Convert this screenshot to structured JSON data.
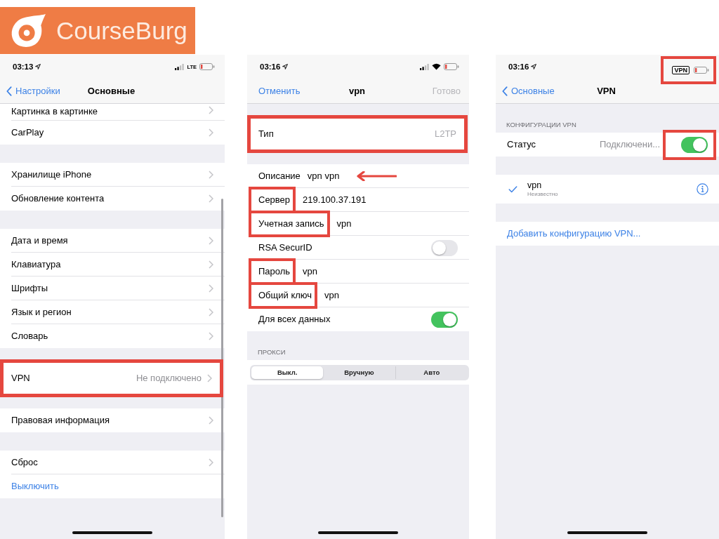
{
  "logo": {
    "name": "CourseBurg"
  },
  "screens": [
    {
      "scrolled": true,
      "status_bar": {
        "time": "03:13",
        "indicators_highlighted": false,
        "indicators": [
          {
            "kind": "signal"
          },
          {
            "kind": "text",
            "text": "LTE"
          },
          {
            "kind": "battery"
          }
        ]
      },
      "nav_bar": {
        "left": {
          "kind": "back",
          "text": "Настройки"
        },
        "title": "Основные"
      },
      "sections": [
        {
          "rows": [
            {
              "kind": "link",
              "label": "Картинка в картинке",
              "highlighted": false
            },
            {
              "kind": "link",
              "label": "CarPlay",
              "highlighted": false
            }
          ]
        },
        {
          "rows": [
            {
              "kind": "link",
              "label": "Хранилище iPhone",
              "highlighted": false
            },
            {
              "kind": "link",
              "label": "Обновление контента",
              "highlighted": false
            }
          ]
        },
        {
          "rows": [
            {
              "kind": "link",
              "label": "Дата и время",
              "highlighted": false
            },
            {
              "kind": "link",
              "label": "Клавиатура",
              "highlighted": false
            },
            {
              "kind": "link",
              "label": "Шрифты",
              "highlighted": false
            },
            {
              "kind": "link",
              "label": "Язык и регион",
              "highlighted": false
            },
            {
              "kind": "link",
              "label": "Словарь",
              "highlighted": false
            }
          ]
        },
        {
          "rows": [
            {
              "kind": "link",
              "label": "VPN",
              "value": "Не подключено",
              "highlighted": true
            }
          ]
        },
        {
          "rows": [
            {
              "kind": "link",
              "label": "Правовая информация",
              "highlighted": false
            }
          ]
        },
        {
          "rows": [
            {
              "kind": "link",
              "label": "Сброс",
              "highlighted": false
            },
            {
              "kind": "action",
              "label": "Выключить",
              "highlighted": false
            }
          ]
        }
      ]
    },
    {
      "scrolled": false,
      "status_bar": {
        "time": "03:16",
        "indicators_highlighted": false,
        "indicators": [
          {
            "kind": "signal"
          },
          {
            "kind": "wifi"
          },
          {
            "kind": "battery"
          }
        ]
      },
      "nav_bar": {
        "left": {
          "kind": "cancel",
          "text": "Отменить"
        },
        "title": "vpn",
        "right": {
          "kind": "done",
          "text": "Готово",
          "disabled": true
        }
      },
      "sections": [
        {
          "rows": [
            {
              "kind": "detail",
              "label": "Тип",
              "value": "L2TP",
              "highlighted": true
            }
          ]
        },
        {
          "rows": [
            {
              "kind": "field",
              "label": "Описание",
              "value": "vpn vpn",
              "label_highlighted": false,
              "arrow": true,
              "highlighted": false
            },
            {
              "kind": "field",
              "label": "Сервер",
              "value": "219.100.37.191",
              "label_highlighted": true,
              "arrow": false,
              "highlighted": false
            },
            {
              "kind": "field",
              "label": "Учетная запись",
              "value": "vpn",
              "label_highlighted": true,
              "arrow": false,
              "highlighted": false
            },
            {
              "kind": "toggle",
              "label": "RSA SecurID",
              "on": false,
              "toggle_highlighted": false,
              "highlighted": false
            },
            {
              "kind": "field",
              "label": "Пароль",
              "value": "vpn",
              "label_highlighted": true,
              "arrow": false,
              "highlighted": false
            },
            {
              "kind": "field",
              "label": "Общий ключ",
              "value": "vpn",
              "label_highlighted": true,
              "arrow": false,
              "highlighted": false
            },
            {
              "kind": "toggle",
              "label": "Для всех данных",
              "on": true,
              "toggle_highlighted": false,
              "highlighted": false
            }
          ]
        },
        {
          "header": "ПРОКСИ",
          "rows": [
            {
              "kind": "segmented",
              "highlighted": false,
              "segments": [
                {
                  "label": "Выкл.",
                  "selected": true
                },
                {
                  "label": "Вручную",
                  "selected": false
                },
                {
                  "label": "Авто",
                  "selected": false
                }
              ]
            }
          ]
        }
      ]
    },
    {
      "scrolled": false,
      "status_bar": {
        "time": "03:16",
        "indicators_highlighted": true,
        "indicators": [
          {
            "kind": "badge",
            "text": "VPN"
          },
          {
            "kind": "battery"
          }
        ]
      },
      "nav_bar": {
        "left": {
          "kind": "back",
          "text": "Основные"
        },
        "title": "VPN"
      },
      "sections": [
        {
          "header": "КОНФИГУРАЦИИ VPN",
          "rows": [
            {
              "kind": "toggle",
              "label": "Статус",
              "value": "Подключени...",
              "on": true,
              "toggle_highlighted": true,
              "highlighted": false
            }
          ]
        },
        {
          "rows": [
            {
              "kind": "config",
              "name": "vpn",
              "status": "Неизвестно",
              "selected": true,
              "highlighted": false
            }
          ]
        },
        {
          "rows": [
            {
              "kind": "action",
              "label": "Добавить конфигурацию VPN...",
              "highlighted": false
            }
          ]
        }
      ]
    }
  ]
}
